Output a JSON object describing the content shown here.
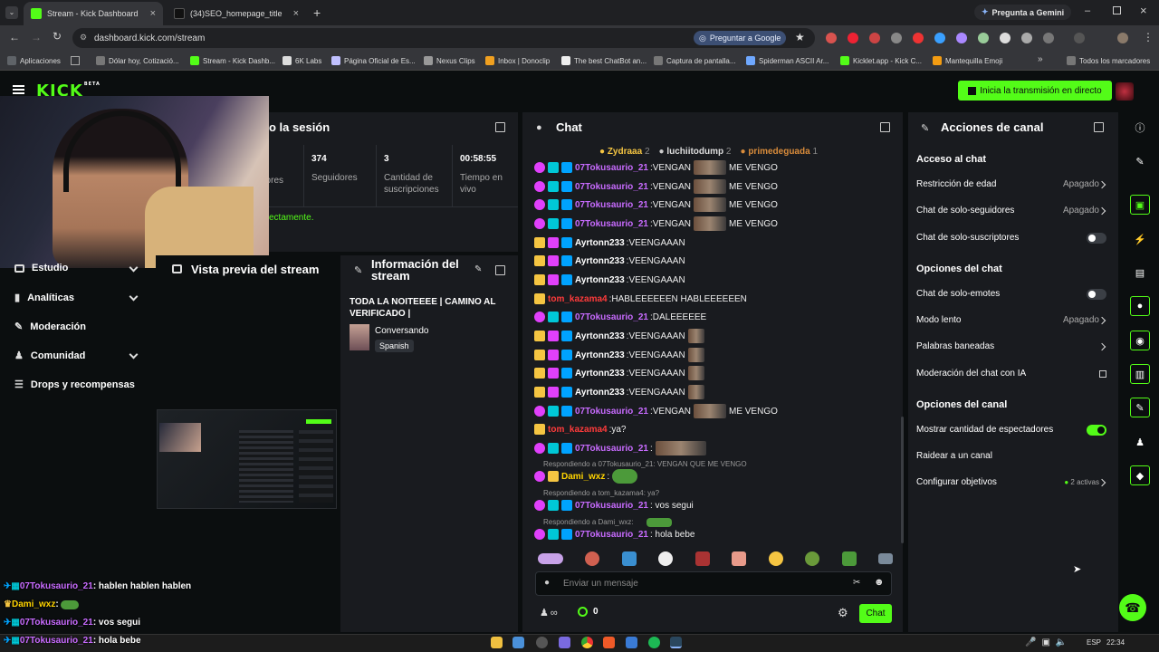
{
  "browser": {
    "tabs": [
      {
        "title": "Stream - Kick Dashboard"
      },
      {
        "title": "(34)SEO_homepage_title"
      }
    ],
    "gemini_label": "Pregunta a Gemini",
    "url": "dashboard.kick.com/stream",
    "google_label": "Preguntar a Google",
    "bookmarks": [
      "Aplicaciones",
      "Dólar hoy, Cotizació...",
      "Stream - Kick Dashb...",
      "6K Labs",
      "Página Oficial de Es...",
      "Nexus Clips",
      "Inbox | Donoclip",
      "The best ChatBot an...",
      "Captura de pantalla...",
      "Spiderman ASCII Ar...",
      "Kicklet.app - Kick C...",
      "Mantequilla Emoji"
    ],
    "all_bookmarks": "Todos los marcadores"
  },
  "header": {
    "logo": "KICK",
    "logo_beta": "BETA",
    "golive_label": "Inicia la transmisión en directo"
  },
  "session": {
    "title_partial": "o la sesión",
    "stats": [
      {
        "value": "",
        "label": "dores"
      },
      {
        "value": "374",
        "label": "Seguidores"
      },
      {
        "value": "3",
        "label": "Cantidad de suscripciones"
      },
      {
        "value": "00:58:55",
        "label": "Tiempo en vivo"
      }
    ],
    "notice": "ectamente."
  },
  "nav": {
    "items": [
      {
        "label": "Estudio"
      },
      {
        "label": "Analíticas"
      },
      {
        "label": "Moderación"
      },
      {
        "label": "Comunidad"
      },
      {
        "label": "Drops y recompensas"
      }
    ]
  },
  "preview": {
    "title": "Vista previa del stream"
  },
  "info": {
    "title": "Información del stream",
    "stream_title": "TODA LA NOITEEEE | CAMINO AL VERIFICADO |",
    "category": "Conversando",
    "language": "Spanish"
  },
  "chat": {
    "title": "Chat",
    "top_gifters": [
      {
        "name": "Zydraaa",
        "count": "2"
      },
      {
        "name": "luchiitodump",
        "count": "2"
      },
      {
        "name": "primedeguada",
        "count": "1"
      }
    ],
    "messages": [
      {
        "user": "07Tokusaurio_21",
        "color": "#c86bff",
        "pre": "VENGAN",
        "post": "ME VENGO"
      },
      {
        "user": "07Tokusaurio_21",
        "color": "#c86bff",
        "pre": "VENGAN",
        "post": "ME VENGO"
      },
      {
        "user": "07Tokusaurio_21",
        "color": "#c86bff",
        "pre": "VENGAN",
        "post": "ME VENGO"
      },
      {
        "user": "07Tokusaurio_21",
        "color": "#c86bff",
        "pre": "VENGAN",
        "post": "ME VENGO"
      },
      {
        "user": "Ayrtonn233",
        "color": "#ffffff",
        "pre": "VEENGAAAN",
        "post": ""
      },
      {
        "user": "Ayrtonn233",
        "color": "#ffffff",
        "pre": "VEENGAAAN",
        "post": ""
      },
      {
        "user": "Ayrtonn233",
        "color": "#ffffff",
        "pre": "VEENGAAAN",
        "post": ""
      },
      {
        "user": "tom_kazama4",
        "color": "#ff3b3b",
        "pre": "HABLEEEEEEN HABLEEEEEEN",
        "post": ""
      },
      {
        "user": "07Tokusaurio_21",
        "color": "#c86bff",
        "pre": "DALEEEEEE",
        "post": ""
      },
      {
        "user": "Ayrtonn233",
        "color": "#ffffff",
        "pre": "VEENGAAAN",
        "post": ""
      },
      {
        "user": "Ayrtonn233",
        "color": "#ffffff",
        "pre": "VEENGAAAN",
        "post": ""
      },
      {
        "user": "Ayrtonn233",
        "color": "#ffffff",
        "pre": "VEENGAAAN",
        "post": ""
      },
      {
        "user": "Ayrtonn233",
        "color": "#ffffff",
        "pre": "VEENGAAAN",
        "post": ""
      },
      {
        "user": "07Tokusaurio_21",
        "color": "#c86bff",
        "pre": "VENGAN",
        "post": "ME VENGO"
      },
      {
        "user": "tom_kazama4",
        "color": "#ff3b3b",
        "pre": "ya?",
        "post": ""
      },
      {
        "user": "07Tokusaurio_21",
        "color": "#c86bff",
        "pre": "",
        "post": ""
      }
    ],
    "replies": [
      {
        "reply_to": "Respondiendo a 07Tokusaurio_21: VENGAN QUE ME VENGO",
        "user": "Dami_wxz",
        "color": "#ffd400",
        "text": ""
      },
      {
        "reply_to": "Respondiendo a tom_kazama4: ya?",
        "user": "07Tokusaurio_21",
        "color": "#c86bff",
        "text": "vos segui"
      },
      {
        "reply_to": "Respondiendo a Dami_wxz:",
        "user": "07Tokusaurio_21",
        "color": "#c86bff",
        "text": "hola bebe"
      }
    ],
    "input_placeholder": "Enviar un mensaje",
    "infinity": "∞",
    "points": "0",
    "send_label": "Chat"
  },
  "actions": {
    "title": "Acciones de canal",
    "section_chat_access": "Acceso al chat",
    "age_restriction": {
      "label": "Restricción de edad",
      "value": "Apagado"
    },
    "followers_only": {
      "label": "Chat de solo-seguidores",
      "value": "Apagado"
    },
    "subs_only": {
      "label": "Chat de solo-suscriptores"
    },
    "section_chat_options": "Opciones del chat",
    "emotes_only": {
      "label": "Chat de solo-emotes"
    },
    "slow_mode": {
      "label": "Modo lento",
      "value": "Apagado"
    },
    "banned_words": {
      "label": "Palabras baneadas"
    },
    "ai_moderation": {
      "label": "Moderación del chat con IA"
    },
    "section_channel_options": "Opciones del canal",
    "show_viewers": {
      "label": "Mostrar cantidad de espectadores"
    },
    "raid": {
      "label": "Raidear a un canal"
    },
    "goals": {
      "label": "Configurar objetivos",
      "value": "2 activas"
    }
  },
  "overlay_chat": [
    {
      "user": "07Tokusaurio_21",
      "text": "hablen hablen hablen"
    },
    {
      "user": "Dami_wxz",
      "text": ""
    },
    {
      "user": "07Tokusaurio_21",
      "text": "vos segui"
    },
    {
      "user": "07Tokusaurio_21",
      "text": "hola bebe"
    }
  ],
  "taskbar": {
    "lang": "ESP",
    "time": "22:34"
  },
  "colors": {
    "accent": "#53fc18",
    "panel": "#191b1f",
    "background": "#0b0e0f"
  }
}
